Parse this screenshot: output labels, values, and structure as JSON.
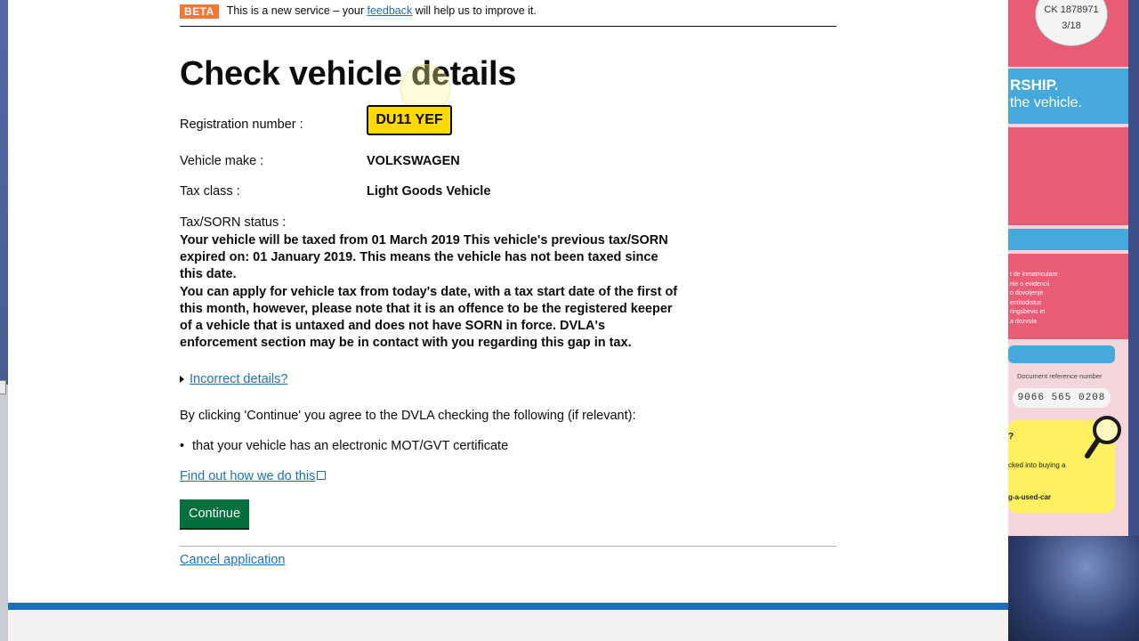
{
  "beta": {
    "tag": "BETA",
    "message_before": "This is a new service – your",
    "feedback_link": "feedback",
    "message_after": "will help us to improve it."
  },
  "page_title": "Check vehicle details",
  "vehicle": {
    "registration_label": "Registration number :",
    "registration_value": "DU11 YEF",
    "make_label": "Vehicle make :",
    "make_value": "VOLKSWAGEN",
    "tax_class_label": "Tax class :",
    "tax_class_value": "Light Goods Vehicle",
    "status_label": "Tax/SORN status :",
    "status_line1": "Your vehicle will be taxed from 01 March 2019 This vehicle's previous tax/SORN expired on: 01 January 2019. This means the vehicle has not been taxed since this date.",
    "status_line2": "You can apply for vehicle tax from today's date, with a tax start date of the first of this month, however, please note that it is an offence to be the registered keeper of a vehicle that is untaxed and does not have SORN in force. DVLA's enforcement section may be in contact with you regarding this gap in tax."
  },
  "incorrect_details": "Incorrect details?",
  "agree_text": "By clicking 'Continue' you agree to the DVLA checking the following (if relevant):",
  "agree_items": [
    "that your vehicle has an electronic MOT/GVT certificate"
  ],
  "find_out_link": "Find out how we do this",
  "continue_button": "Continue",
  "cancel_link": "Cancel application",
  "document_photo": {
    "stamp_line1": "CK 1878971",
    "stamp_line2": "3/18",
    "heading_fragment": "RSHIP.",
    "sub_fragment": "the vehicle.",
    "languages": [
      "t de inmatriculare",
      "nie o evidencii",
      "o dovoljenje",
      "entitodistus",
      "ringsbevis et",
      "a dozvola"
    ],
    "ref_label": "Document reference number",
    "ref_number": "9066 565 0208",
    "yellow_q": "?",
    "yellow_line1": "cked into buying a",
    "yellow_line2": "g-a-used-car"
  },
  "colors": {
    "beta": "#f47738",
    "link": "#1d70b8",
    "plate": "#ffd900",
    "button": "#00703c",
    "footer": "#1d70b8"
  }
}
